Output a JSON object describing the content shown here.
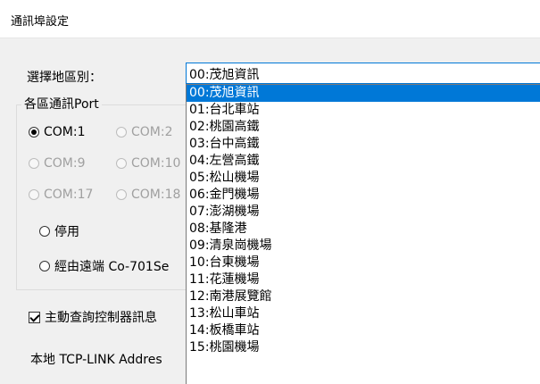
{
  "window": {
    "title": "通訊埠設定"
  },
  "region": {
    "label": "選擇地區別：",
    "selected": "00:茂旭資訊",
    "options": [
      "00:茂旭資訊",
      "01:台北車站",
      "02:桃園高鐵",
      "03:台中高鐵",
      "04:左營高鐵",
      "05:松山機場",
      "06:金門機場",
      "07:澎湖機場",
      "08:基隆港",
      "09:清泉崗機場",
      "10:台東機場",
      "11:花蓮機場",
      "12:南港展覽館",
      "13:松山車站",
      "14:板橋車站",
      "15:桃園機場"
    ]
  },
  "port_group": {
    "title": "各區通訊Port",
    "com_ports": [
      "COM:1",
      "COM:2",
      "COM:9",
      "COM:10",
      "COM:17",
      "COM:18"
    ],
    "selected_port": "COM:1",
    "disable_label": "停用",
    "remote_label": "經由遠端 Co-701Se"
  },
  "active_query": {
    "label": "主動查詢控制器訊息",
    "checked": true
  },
  "tcp_link": {
    "label": "本地 TCP-LINK Addres"
  }
}
